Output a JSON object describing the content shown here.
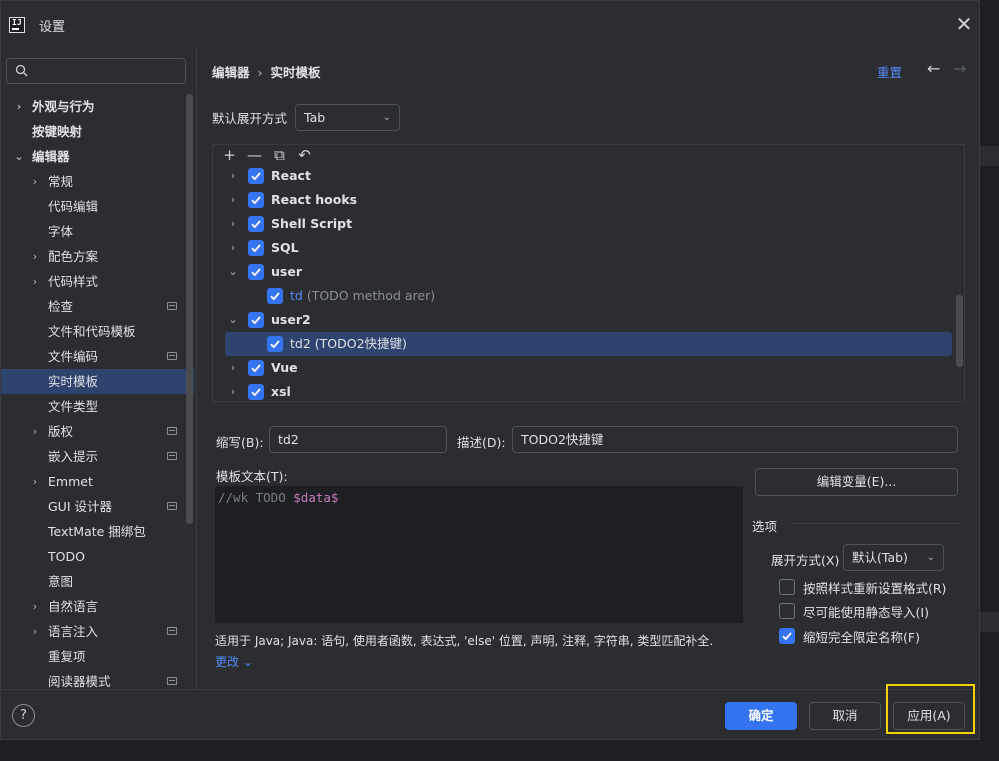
{
  "window": {
    "title": "设置",
    "close_glyph": "✕"
  },
  "search": {
    "value": "",
    "placeholder": ""
  },
  "nav": [
    {
      "label": "外观与行为",
      "bold": true,
      "level": 0,
      "chevron": "›",
      "proj": false
    },
    {
      "label": "按键映射",
      "bold": true,
      "level": 0,
      "chevron": "",
      "proj": false
    },
    {
      "label": "编辑器",
      "bold": true,
      "level": 0,
      "chevron": "⌄",
      "proj": false
    },
    {
      "label": "常规",
      "bold": false,
      "level": 1,
      "chevron": "›",
      "proj": false
    },
    {
      "label": "代码编辑",
      "bold": false,
      "level": 1,
      "chevron": "",
      "proj": false
    },
    {
      "label": "字体",
      "bold": false,
      "level": 1,
      "chevron": "",
      "proj": false
    },
    {
      "label": "配色方案",
      "bold": false,
      "level": 1,
      "chevron": "›",
      "proj": false
    },
    {
      "label": "代码样式",
      "bold": false,
      "level": 1,
      "chevron": "›",
      "proj": false
    },
    {
      "label": "检查",
      "bold": false,
      "level": 1,
      "chevron": "",
      "proj": true
    },
    {
      "label": "文件和代码模板",
      "bold": false,
      "level": 1,
      "chevron": "",
      "proj": false
    },
    {
      "label": "文件编码",
      "bold": false,
      "level": 1,
      "chevron": "",
      "proj": true
    },
    {
      "label": "实时模板",
      "bold": false,
      "level": 1,
      "chevron": "",
      "proj": false,
      "selected": true
    },
    {
      "label": "文件类型",
      "bold": false,
      "level": 1,
      "chevron": "",
      "proj": false
    },
    {
      "label": "版权",
      "bold": false,
      "level": 1,
      "chevron": "›",
      "proj": true
    },
    {
      "label": "嵌入提示",
      "bold": false,
      "level": 1,
      "chevron": "",
      "proj": true
    },
    {
      "label": "Emmet",
      "bold": false,
      "level": 1,
      "chevron": "›",
      "proj": false
    },
    {
      "label": "GUI 设计器",
      "bold": false,
      "level": 1,
      "chevron": "",
      "proj": true
    },
    {
      "label": "TextMate 捆绑包",
      "bold": false,
      "level": 1,
      "chevron": "",
      "proj": false
    },
    {
      "label": "TODO",
      "bold": false,
      "level": 1,
      "chevron": "",
      "proj": false
    },
    {
      "label": "意图",
      "bold": false,
      "level": 1,
      "chevron": "",
      "proj": false
    },
    {
      "label": "自然语言",
      "bold": false,
      "level": 1,
      "chevron": "›",
      "proj": false
    },
    {
      "label": "语言注入",
      "bold": false,
      "level": 1,
      "chevron": "›",
      "proj": true
    },
    {
      "label": "重复项",
      "bold": false,
      "level": 1,
      "chevron": "",
      "proj": false
    },
    {
      "label": "阅读器模式",
      "bold": false,
      "level": 1,
      "chevron": "",
      "proj": true
    }
  ],
  "breadcrumb": {
    "parent": "编辑器",
    "separator": "›",
    "current": "实时模板"
  },
  "header": {
    "reset": "重置",
    "back": "←",
    "forward": "→"
  },
  "expand": {
    "label": "默认展开方式",
    "value": "Tab"
  },
  "toolbar": {
    "add": "+",
    "remove": "—",
    "copy": "⧉",
    "revert": "↶"
  },
  "tree": [
    {
      "type": "group",
      "name": "React",
      "expanded": false,
      "checked": true
    },
    {
      "type": "group",
      "name": "React hooks",
      "expanded": false,
      "checked": true
    },
    {
      "type": "group",
      "name": "Shell Script",
      "expanded": false,
      "checked": true
    },
    {
      "type": "group",
      "name": "SQL",
      "expanded": false,
      "checked": true
    },
    {
      "type": "group",
      "name": "user",
      "expanded": true,
      "checked": true
    },
    {
      "type": "template",
      "abbr": "td",
      "desc": " (TODO method arer)",
      "checked": true,
      "selected": false
    },
    {
      "type": "group",
      "name": "user2",
      "expanded": true,
      "checked": true
    },
    {
      "type": "template",
      "abbr": "td2",
      "desc": " (TODO2快捷键)",
      "checked": true,
      "selected": true
    },
    {
      "type": "group",
      "name": "Vue",
      "expanded": false,
      "checked": true
    },
    {
      "type": "group",
      "name": "xsl",
      "expanded": false,
      "checked": true
    }
  ],
  "form": {
    "abbr_label": "缩写(B):",
    "abbr_value": "td2",
    "desc_label": "描述(D):",
    "desc_value": "TODO2快捷键",
    "template_label": "模板文本(T):",
    "template_comment": "//wk TODO ",
    "template_var": "$data$",
    "edit_vars": "编辑变量(E)..."
  },
  "options": {
    "title": "选项",
    "expand_label": "展开方式(X)",
    "expand_value": "默认(Tab)",
    "items": [
      {
        "label": "按照样式重新设置格式(R)",
        "checked": false
      },
      {
        "label": "尽可能使用静态导入(I)",
        "checked": false
      },
      {
        "label": "缩短完全限定名称(F)",
        "checked": true
      }
    ]
  },
  "applies": {
    "text": "适用于 Java; Java: 语句, 使用者函数, 表达式, 'else' 位置, 声明, 注释, 字符串, 类型匹配补全.",
    "more": "更改 ⌄"
  },
  "footer": {
    "help": "?",
    "ok": "确定",
    "cancel": "取消",
    "apply": "应用(A)"
  },
  "colors": {
    "accent": "#3574f0",
    "link": "#548af7",
    "selection": "#2e436e",
    "highlight": "#f5d000"
  }
}
